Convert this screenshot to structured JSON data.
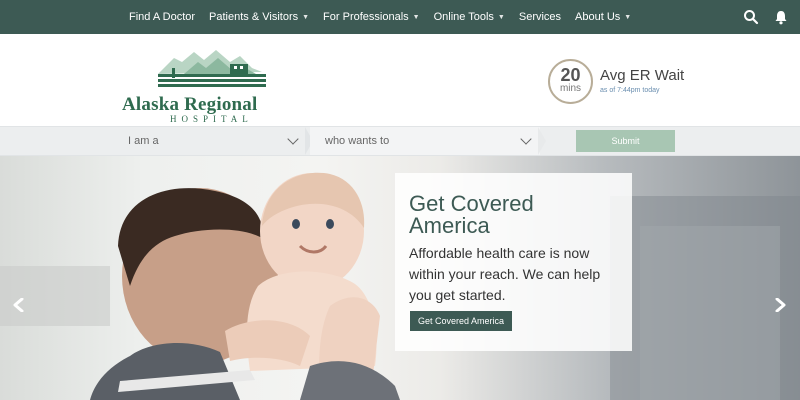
{
  "nav": {
    "items": [
      {
        "label": "Find A Doctor",
        "dropdown": false
      },
      {
        "label": "Patients & Visitors",
        "dropdown": true
      },
      {
        "label": "For Professionals",
        "dropdown": true
      },
      {
        "label": "Online Tools",
        "dropdown": true
      },
      {
        "label": "Services",
        "dropdown": false
      },
      {
        "label": "About Us",
        "dropdown": true
      }
    ],
    "icons": [
      "search-icon",
      "bell-icon"
    ]
  },
  "logo": {
    "name": "Alaska Regional",
    "subtitle": "HOSPITAL"
  },
  "er_wait": {
    "minutes": "20",
    "unit": "mins",
    "title": "Avg ER Wait",
    "time": "as of 7:44pm today"
  },
  "selector": {
    "i_am": "I am a",
    "who_wants": "who wants to",
    "submit": "Submit"
  },
  "hero": {
    "title": "Get Covered America",
    "text": "Affordable health care is now within your reach. We can help you get started.",
    "button": "Get Covered America"
  },
  "colors": {
    "brand": "#3d5a54",
    "logo_green": "#2f6b4f",
    "submit": "#a8c6b3",
    "er_ring": "#b8ad98",
    "time_blue": "#6a8eaf"
  }
}
